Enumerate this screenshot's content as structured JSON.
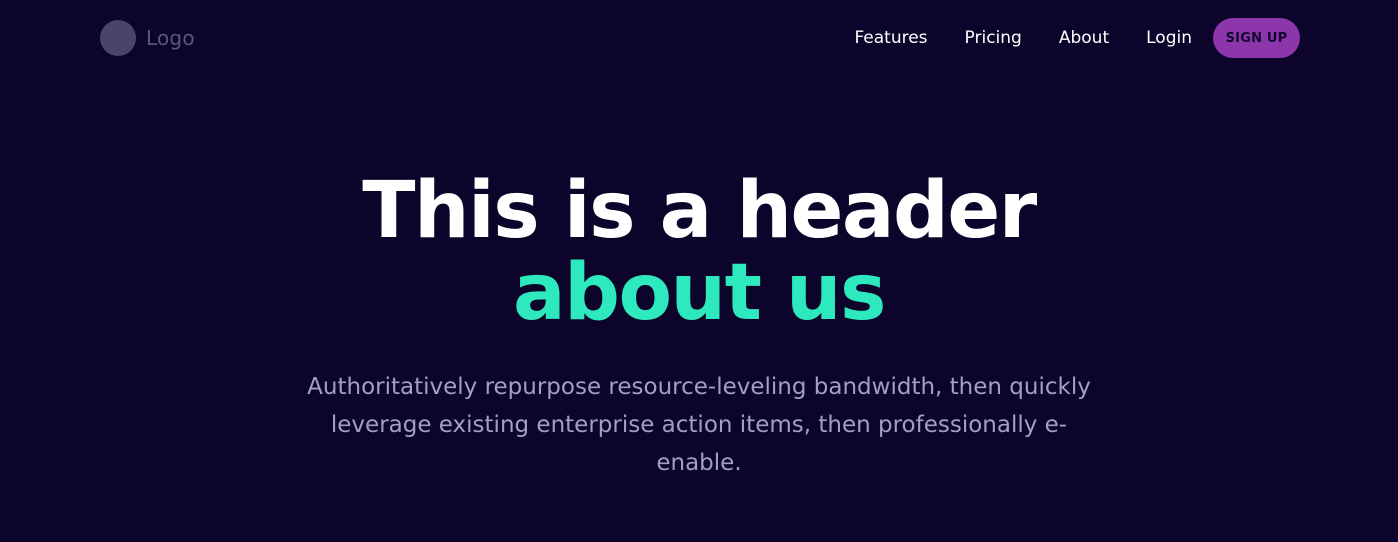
{
  "nav": {
    "logo_text": "Logo",
    "links": [
      {
        "label": "Features"
      },
      {
        "label": "Pricing"
      },
      {
        "label": "About"
      },
      {
        "label": "Login"
      }
    ],
    "signup_label": "SIGN UP"
  },
  "hero": {
    "title_plain": "This is a header ",
    "title_accent": "about us",
    "subtitle": "Authoritatively repurpose resource-leveling bandwidth, then quickly leverage existing enterprise action items, then professionally e-enable."
  },
  "colors": {
    "background": "#0c042a",
    "accent": "#2de9bd",
    "signup_button": "#8d35ab",
    "subtitle_text": "#a39fc0"
  }
}
